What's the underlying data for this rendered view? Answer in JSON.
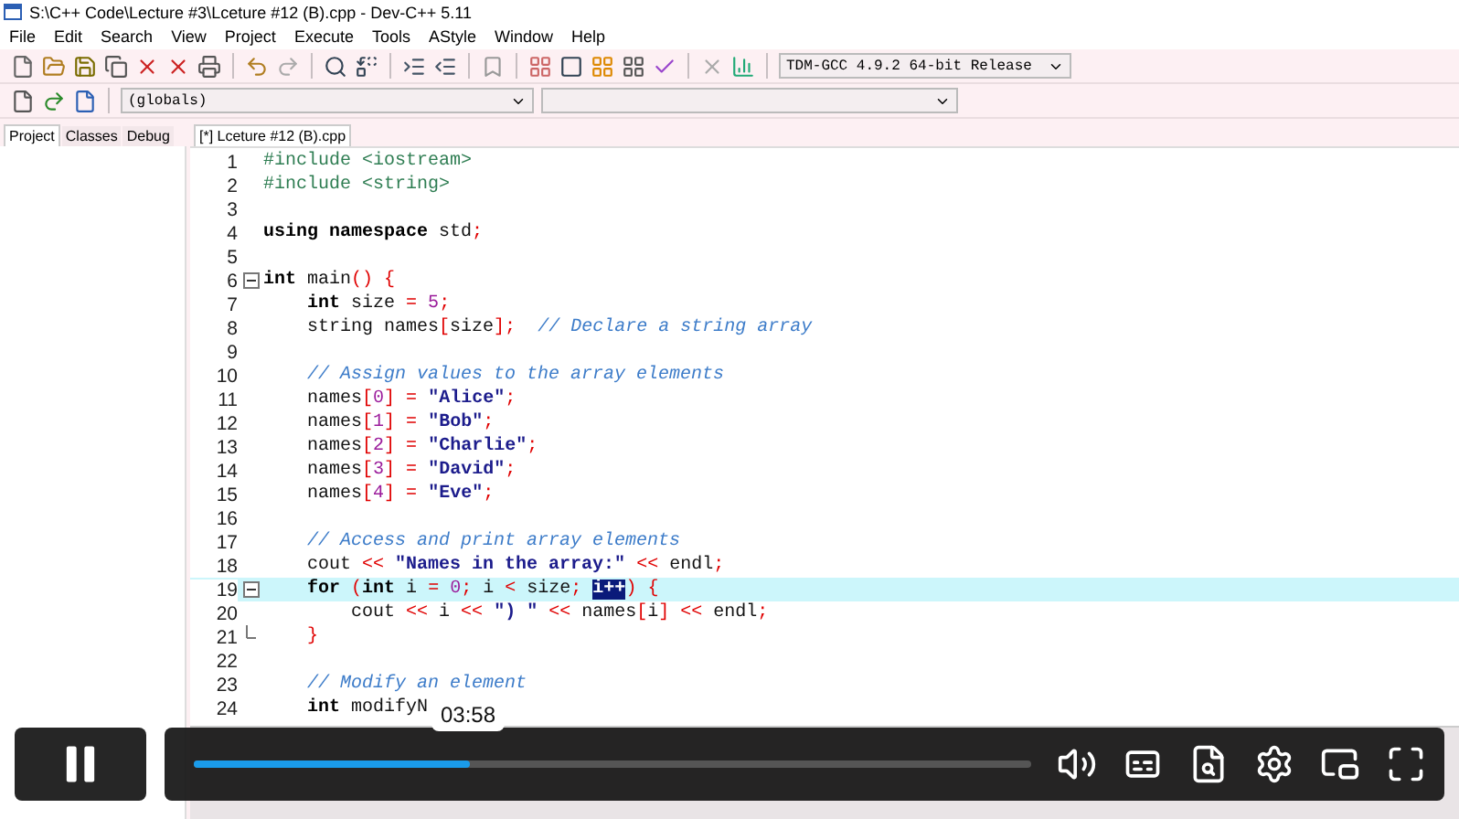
{
  "window": {
    "title": "S:\\C++ Code\\Lecture #3\\Lceture #12 (B).cpp - Dev-C++ 5.11"
  },
  "menu": [
    "File",
    "Edit",
    "Search",
    "View",
    "Project",
    "Execute",
    "Tools",
    "AStyle",
    "Window",
    "Help"
  ],
  "toolbar": {
    "compiler": "TDM-GCC 4.9.2 64-bit Release",
    "scope": "(globals)"
  },
  "left_tabs": [
    {
      "label": "Project",
      "selected": true
    },
    {
      "label": "Classes",
      "selected": false
    },
    {
      "label": "Debug",
      "selected": false
    }
  ],
  "editor_tabs": [
    {
      "label": "[*] Lceture #12 (B).cpp",
      "selected": true
    }
  ],
  "code": [
    {
      "number": "1",
      "current": false,
      "kind": "plain",
      "tokens": [
        {
          "kind": "pp",
          "t": "#include <iostream>"
        }
      ]
    },
    {
      "number": "2",
      "current": false,
      "kind": "plain",
      "tokens": [
        {
          "kind": "pp",
          "t": "#include <string>"
        }
      ]
    },
    {
      "number": "3",
      "current": false,
      "kind": "plain"
    },
    {
      "number": "4",
      "current": false,
      "kind": "plain",
      "tokens": [
        {
          "kind": "kw",
          "t": "using namespace"
        },
        {
          "kind": "pl",
          "t": " std"
        },
        {
          "kind": "sym",
          "t": ";"
        }
      ]
    },
    {
      "number": "5",
      "current": false,
      "kind": "plain"
    },
    {
      "number": "6",
      "current": false,
      "kind": "fold-start",
      "tokens": [
        {
          "kind": "kw",
          "t": "int"
        },
        {
          "kind": "pl",
          "t": " main"
        },
        {
          "kind": "sym",
          "t": "() {"
        }
      ]
    },
    {
      "number": "7",
      "current": false,
      "kind": "plain",
      "tokens": [
        {
          "kind": "kw",
          "t": "    int"
        },
        {
          "kind": "pl",
          "t": " size "
        },
        {
          "kind": "sym",
          "t": "="
        },
        {
          "kind": "num",
          "t": " 5"
        },
        {
          "kind": "sym",
          "t": ";"
        }
      ]
    },
    {
      "number": "8",
      "current": false,
      "kind": "plain",
      "tokens": [
        {
          "kind": "pl",
          "t": "    string names"
        },
        {
          "kind": "sym",
          "t": "["
        },
        {
          "kind": "pl",
          "t": "size"
        },
        {
          "kind": "sym",
          "t": "];"
        },
        {
          "kind": "cm",
          "t": "  // Declare a string array"
        }
      ]
    },
    {
      "number": "9",
      "current": false,
      "kind": "plain"
    },
    {
      "number": "10",
      "current": false,
      "kind": "plain",
      "tokens": [
        {
          "kind": "cm",
          "t": "    // Assign values to the array elements"
        }
      ]
    },
    {
      "number": "11",
      "current": false,
      "kind": "plain",
      "tokens": [
        {
          "kind": "pl",
          "t": "    names"
        },
        {
          "kind": "sym",
          "t": "["
        },
        {
          "kind": "num",
          "t": "0"
        },
        {
          "kind": "sym",
          "t": "] = "
        },
        {
          "kind": "str",
          "t": "\"Alice\""
        },
        {
          "kind": "sym",
          "t": ";"
        }
      ]
    },
    {
      "number": "12",
      "current": false,
      "kind": "plain",
      "tokens": [
        {
          "kind": "pl",
          "t": "    names"
        },
        {
          "kind": "sym",
          "t": "["
        },
        {
          "kind": "num",
          "t": "1"
        },
        {
          "kind": "sym",
          "t": "] = "
        },
        {
          "kind": "str",
          "t": "\"Bob\""
        },
        {
          "kind": "sym",
          "t": ";"
        }
      ]
    },
    {
      "number": "13",
      "current": false,
      "kind": "plain",
      "tokens": [
        {
          "kind": "pl",
          "t": "    names"
        },
        {
          "kind": "sym",
          "t": "["
        },
        {
          "kind": "num",
          "t": "2"
        },
        {
          "kind": "sym",
          "t": "] = "
        },
        {
          "kind": "str",
          "t": "\"Charlie\""
        },
        {
          "kind": "sym",
          "t": ";"
        }
      ]
    },
    {
      "number": "14",
      "current": false,
      "kind": "plain",
      "tokens": [
        {
          "kind": "pl",
          "t": "    names"
        },
        {
          "kind": "sym",
          "t": "["
        },
        {
          "kind": "num",
          "t": "3"
        },
        {
          "kind": "sym",
          "t": "] = "
        },
        {
          "kind": "str",
          "t": "\"David\""
        },
        {
          "kind": "sym",
          "t": ";"
        }
      ]
    },
    {
      "number": "15",
      "current": false,
      "kind": "plain",
      "tokens": [
        {
          "kind": "pl",
          "t": "    names"
        },
        {
          "kind": "sym",
          "t": "["
        },
        {
          "kind": "num",
          "t": "4"
        },
        {
          "kind": "sym",
          "t": "] = "
        },
        {
          "kind": "str",
          "t": "\"Eve\""
        },
        {
          "kind": "sym",
          "t": ";"
        }
      ]
    },
    {
      "number": "16",
      "current": false,
      "kind": "plain"
    },
    {
      "number": "17",
      "current": false,
      "kind": "plain",
      "tokens": [
        {
          "kind": "cm",
          "t": "    // Access and print array elements"
        }
      ]
    },
    {
      "number": "18",
      "current": false,
      "kind": "plain",
      "tokens": [
        {
          "kind": "pl",
          "t": "    cout "
        },
        {
          "kind": "sym",
          "t": "<<"
        },
        {
          "kind": "str",
          "t": " \"Names in the array:\""
        },
        {
          "kind": "sym",
          "t": " <<"
        },
        {
          "kind": "pl",
          "t": " endl"
        },
        {
          "kind": "sym",
          "t": ";"
        }
      ]
    },
    {
      "number": "19",
      "current": true,
      "kind": "fold-start",
      "tokens": [
        {
          "kind": "kw",
          "t": "    for"
        },
        {
          "kind": "sym",
          "t": " ("
        },
        {
          "kind": "kw",
          "t": "int"
        },
        {
          "kind": "pl",
          "t": " i "
        },
        {
          "kind": "sym",
          "t": "="
        },
        {
          "kind": "num",
          "t": " 0"
        },
        {
          "kind": "sym",
          "t": ";"
        },
        {
          "kind": "pl",
          "t": " i "
        },
        {
          "kind": "sym",
          "t": "<"
        },
        {
          "kind": "pl",
          "t": " size"
        },
        {
          "kind": "sym",
          "t": "; "
        },
        {
          "kind": "sel",
          "t": "i++"
        },
        {
          "kind": "sym",
          "t": ") {"
        }
      ]
    },
    {
      "number": "20",
      "current": false,
      "kind": "plain",
      "tokens": [
        {
          "kind": "pl",
          "t": "        cout "
        },
        {
          "kind": "sym",
          "t": "<<"
        },
        {
          "kind": "pl",
          "t": " i "
        },
        {
          "kind": "sym",
          "t": "<<"
        },
        {
          "kind": "str",
          "t": " \") \" "
        },
        {
          "kind": "sym",
          "t": "<<"
        },
        {
          "kind": "pl",
          "t": " names"
        },
        {
          "kind": "sym",
          "t": "["
        },
        {
          "kind": "pl",
          "t": "i"
        },
        {
          "kind": "sym",
          "t": "] <<"
        },
        {
          "kind": "pl",
          "t": " endl"
        },
        {
          "kind": "sym",
          "t": ";"
        }
      ]
    },
    {
      "number": "21",
      "current": false,
      "kind": "fold-end",
      "tokens": [
        {
          "kind": "sym",
          "t": "    }"
        }
      ]
    },
    {
      "number": "22",
      "current": false,
      "kind": "plain"
    },
    {
      "number": "23",
      "current": false,
      "kind": "plain",
      "tokens": [
        {
          "kind": "cm",
          "t": "    // Modify an element"
        }
      ]
    },
    {
      "number": "24",
      "current": false,
      "kind": "plain",
      "tokens": [
        {
          "kind": "kw",
          "t": "    int"
        },
        {
          "kind": "pl",
          "t": " modifyN"
        }
      ]
    }
  ],
  "player": {
    "playing": true,
    "level": 0.33,
    "time": "03:58"
  }
}
